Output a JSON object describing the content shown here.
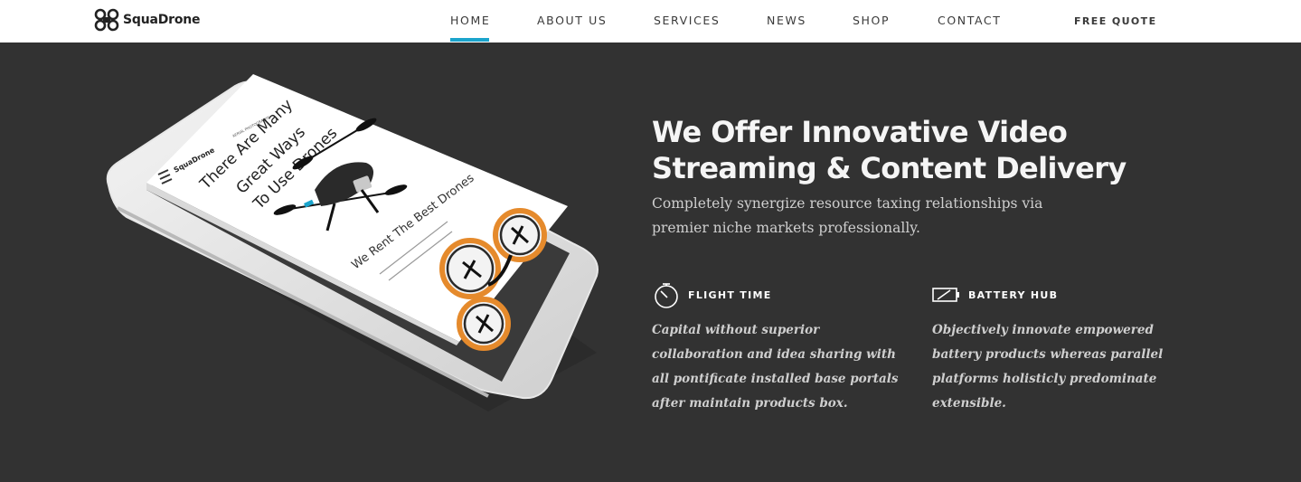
{
  "brand": {
    "name": "SquaDrone",
    "accent": "#1ba4cc"
  },
  "nav": {
    "items": [
      {
        "label": "HOME",
        "active": true
      },
      {
        "label": "ABOUT US",
        "active": false
      },
      {
        "label": "SERVICES",
        "active": false
      },
      {
        "label": "NEWS",
        "active": false
      },
      {
        "label": "SHOP",
        "active": false
      },
      {
        "label": "CONTACT",
        "active": false
      }
    ],
    "cta": "FREE QUOTE"
  },
  "hero": {
    "title": "We Offer Innovative Video Streaming & Content Delivery",
    "subtitle": "Completely synergize resource taxing relationships via premier niche markets professionally."
  },
  "mockup": {
    "kicker": "AERIAL PHOTOGRAPHY",
    "heading_lines": [
      "There Are Many",
      "Great Ways",
      "To Use Drones"
    ],
    "subheading": "We Rent The Best Drones",
    "logo": "SquaDrone"
  },
  "features": [
    {
      "icon": "stopwatch-icon",
      "title": "FLIGHT TIME",
      "text": "Capital without superior collaboration and idea sharing with all pontificate installed base portals after maintain products box."
    },
    {
      "icon": "battery-icon",
      "title": "BATTERY HUB",
      "text": "Objectively innovate empowered battery products whereas parallel platforms holisticly predominate extensible."
    }
  ]
}
